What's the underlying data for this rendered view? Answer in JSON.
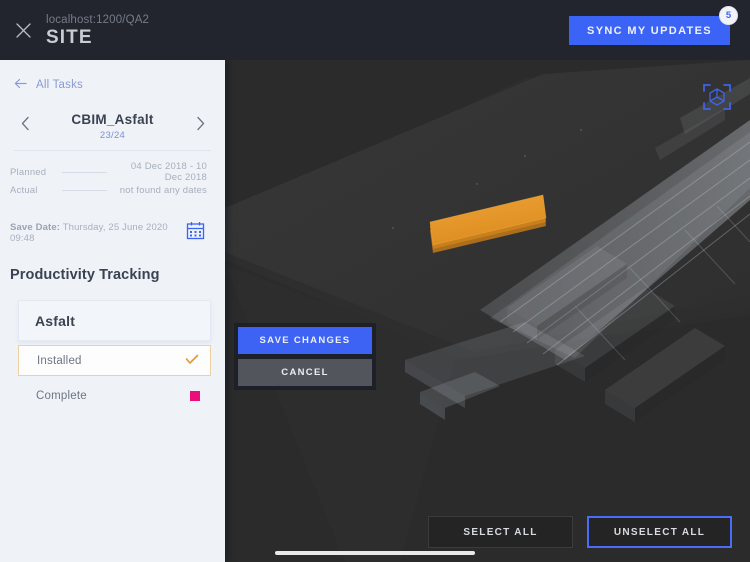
{
  "header": {
    "close_icon": "close-icon",
    "url": "localhost:1200/QA2",
    "title": "SITE",
    "sync_label": "SYNC MY UPDATES",
    "sync_badge": "5",
    "accent_blue": "#3b63f6",
    "bar_color": "#22252e"
  },
  "sidebar": {
    "back_label": "All Tasks",
    "back_icon": "arrow-left-icon",
    "prev_icon": "chevron-left-icon",
    "next_icon": "chevron-right-icon",
    "task_name": "CBIM_Asfalt",
    "task_count": "23/24",
    "meta": [
      {
        "label": "Planned",
        "value": "04 Dec 2018 - 10 Dec 2018"
      },
      {
        "label": "Actual",
        "value": "not found any dates"
      }
    ],
    "save_date_label": "Save Date:",
    "save_date_value": "Thursday, 25 June 2020 09:48",
    "calendar_icon": "calendar-icon",
    "section_title": "Productivity Tracking",
    "selected_material": "Asfalt",
    "options": [
      {
        "label": "Installed",
        "state": "selected",
        "marker": "check-icon",
        "color": "#e8962e"
      },
      {
        "label": "Complete",
        "state": "unselected",
        "marker": "color-swatch",
        "color": "#ec0e7b"
      }
    ],
    "background": "#eff3f8"
  },
  "viewport": {
    "focus_icon": "fit-to-view-icon",
    "background": "#2b2b2b",
    "highlight_color": "#e8962e",
    "model_description": "translucent bridge deck with girders, highlighted asphalt slab"
  },
  "modal": {
    "save_label": "SAVE CHANGES",
    "cancel_label": "CANCEL",
    "save_color": "#3d63f5",
    "cancel_color": "#52555c"
  },
  "bottom_actions": {
    "select_all_label": "SELECT ALL",
    "unselect_all_label": "UNSELECT ALL",
    "active_outline": "#4a6cf7"
  }
}
